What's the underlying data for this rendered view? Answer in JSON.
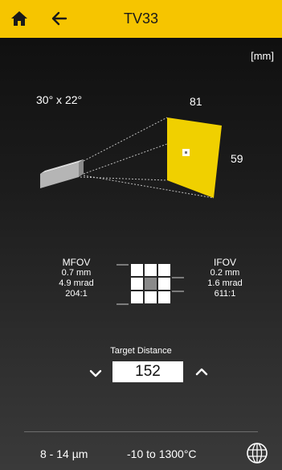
{
  "header": {
    "title": "TV33",
    "home_icon": "home-icon",
    "back_icon": "arrow-left-icon"
  },
  "unit_label": "[mm]",
  "fov": {
    "angle_label": "30° x 22°",
    "width": "81",
    "height": "59"
  },
  "mfov": {
    "title": "MFOV",
    "size": "0.7 mm",
    "angle": "4.9 mrad",
    "ratio": "204:1"
  },
  "ifov": {
    "title": "IFOV",
    "size": "0.2 mm",
    "angle": "1.6 mrad",
    "ratio": "611:1"
  },
  "target_distance": {
    "label": "Target Distance",
    "value": "152"
  },
  "footer": {
    "spectral_range": "8 - 14 µm",
    "temperature_range": "-10 to 1300°C",
    "globe_icon": "globe-icon"
  },
  "colors": {
    "header": "#f6c500",
    "target": "#f0d000"
  }
}
